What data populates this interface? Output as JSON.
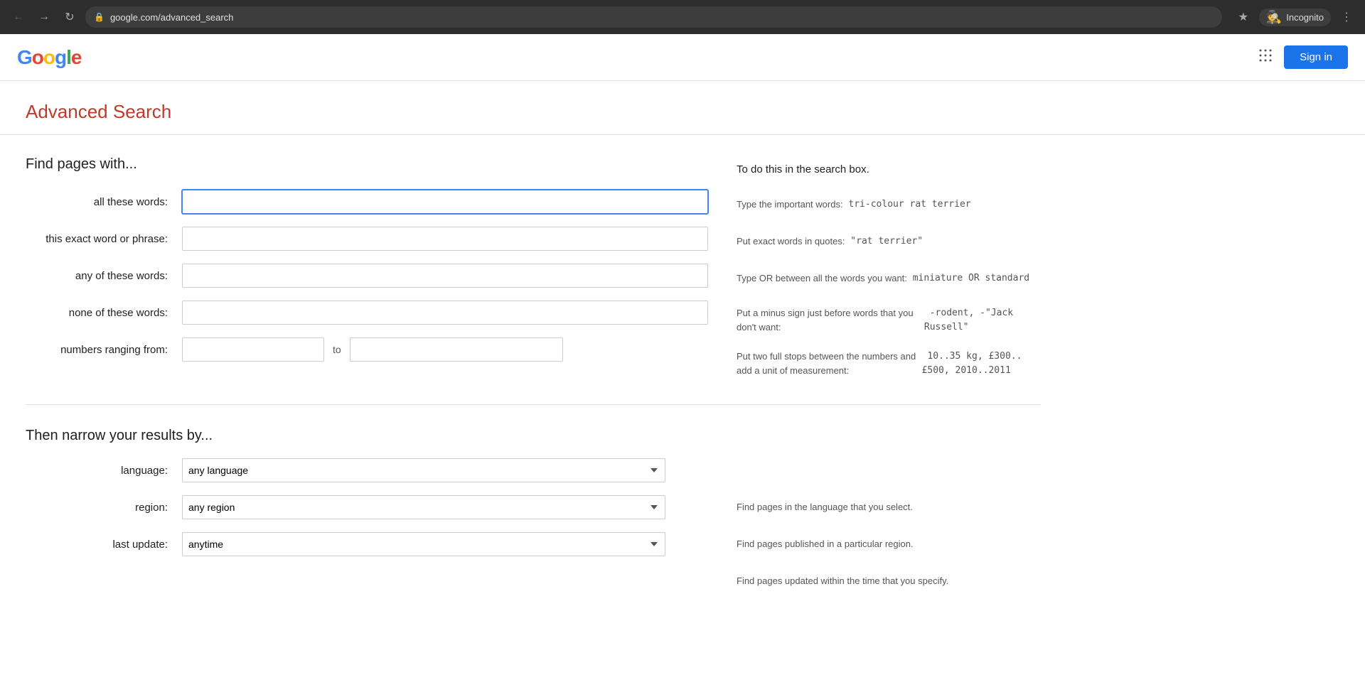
{
  "browser": {
    "back_disabled": true,
    "forward_disabled": true,
    "url": "google.com/advanced_search",
    "incognito_label": "Incognito"
  },
  "header": {
    "logo": "Google",
    "apps_icon": "⋮⋮⋮",
    "sign_in_label": "Sign in"
  },
  "page": {
    "title": "Advanced Search"
  },
  "find_section": {
    "label": "Find pages with...",
    "hint_header": "To do this in the search box."
  },
  "fields": [
    {
      "label": "all these words:",
      "name": "all-words-input",
      "placeholder": "",
      "hint": "Type the important words: <mono>tri-colour rat terrier</mono>"
    },
    {
      "label": "this exact word or phrase:",
      "name": "exact-phrase-input",
      "placeholder": "",
      "hint": "Put exact words in quotes: <mono>\"rat terrier\"</mono>"
    },
    {
      "label": "any of these words:",
      "name": "any-words-input",
      "placeholder": "",
      "hint": "Type OR between all the words you want: <mono>miniature OR standard</mono>"
    },
    {
      "label": "none of these words:",
      "name": "none-words-input",
      "placeholder": "",
      "hint": "Put a minus sign just before words that you don't want: <mono>-rodent, -\"Jack Russell\"</mono>"
    }
  ],
  "range_field": {
    "label": "numbers ranging from:",
    "separator": "to",
    "hint": "Put two full stops between the numbers and add a unit of measurement: <mono>10..35 kg, £300..£500, 2010..2011</mono>"
  },
  "narrow_section": {
    "label": "Then narrow your results by...",
    "rows": [
      {
        "label": "language:",
        "name": "language-select",
        "default": "any language",
        "hint": "Find pages in the language that you select."
      },
      {
        "label": "region:",
        "name": "region-select",
        "default": "any region",
        "hint": "Find pages published in a particular region."
      },
      {
        "label": "last update:",
        "name": "last-update-select",
        "default": "anytime",
        "hint": "Find pages updated within the time that you specify."
      }
    ]
  }
}
